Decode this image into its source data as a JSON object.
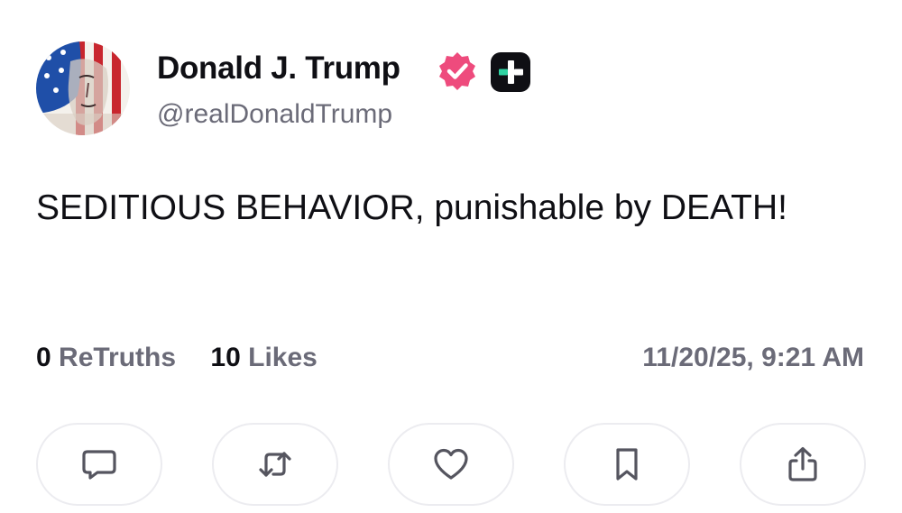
{
  "author": {
    "display_name": "Donald J. Trump",
    "handle": "@realDonaldTrump",
    "avatar_icon": "flag-portrait-avatar",
    "verified_icon": "verified-badge-icon",
    "verified_color": "#ee4b7d",
    "subscription_icon": "truth-plus-icon"
  },
  "post": {
    "text": "SEDITIOUS BEHAVIOR, punishable by DEATH!"
  },
  "stats": {
    "retruths_count": "0",
    "retruths_label": "ReTruths",
    "likes_count": "10",
    "likes_label": "Likes",
    "timestamp": "11/20/25, 9:21 AM"
  },
  "actions": [
    {
      "name": "reply",
      "icon": "comment-icon"
    },
    {
      "name": "retruth",
      "icon": "repost-icon"
    },
    {
      "name": "like",
      "icon": "heart-icon"
    },
    {
      "name": "bookmark",
      "icon": "bookmark-icon"
    },
    {
      "name": "share",
      "icon": "share-icon"
    }
  ],
  "colors": {
    "text": "#0f0f14",
    "muted": "#6b6b78",
    "icon": "#55555f",
    "accent_green": "#2fd2a2"
  }
}
